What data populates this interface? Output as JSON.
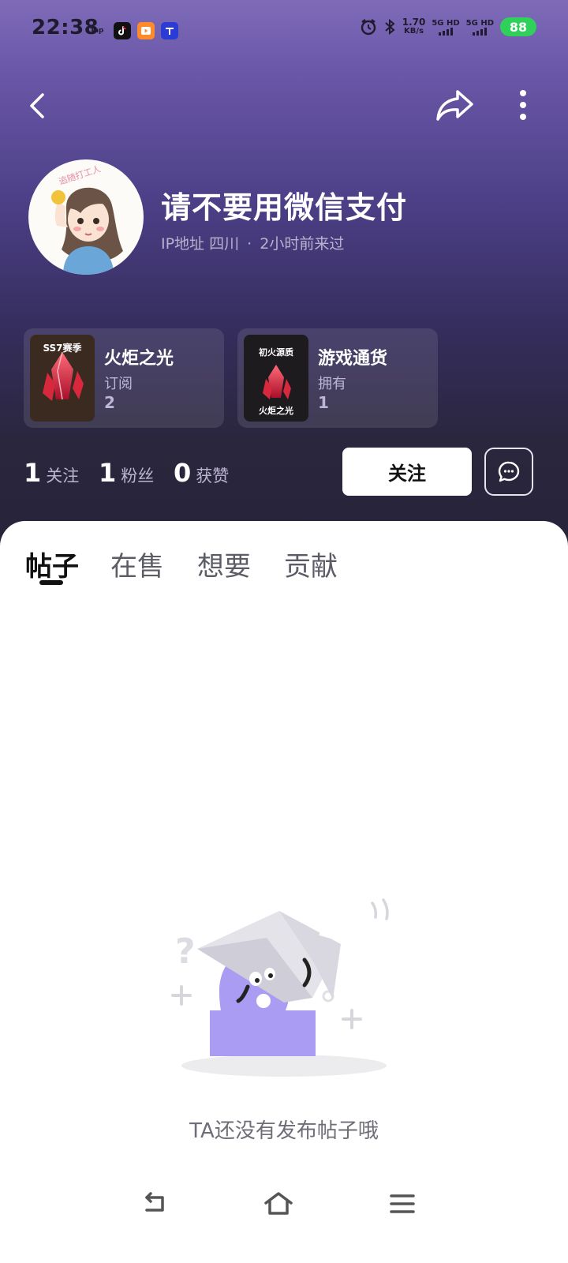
{
  "status_bar": {
    "time": "22:38",
    "apps": [
      "Tap",
      "douyin-icon",
      "video-app-icon",
      "qianyou-app-icon"
    ],
    "net_speed_value": "1.70",
    "net_speed_unit": "KB/s",
    "sim1": "5G HD",
    "sim2": "5G HD",
    "battery": "88"
  },
  "profile": {
    "username": "请不要用微信支付",
    "ip_location": "IP地址 四川",
    "separator": "·",
    "last_seen": "2小时前来过",
    "avatar_caption": "追随打工人"
  },
  "cards": [
    {
      "thumb_label": "SS7赛季",
      "title": "火炬之光",
      "subtitle": "订阅",
      "count": "2"
    },
    {
      "thumb_label_top": "初火源质",
      "thumb_label_bottom": "火炬之光",
      "title": "游戏通货",
      "subtitle": "拥有",
      "count": "1"
    }
  ],
  "stats": [
    {
      "num": "1",
      "label": "关注"
    },
    {
      "num": "1",
      "label": "粉丝"
    },
    {
      "num": "0",
      "label": "获赞"
    }
  ],
  "actions": {
    "follow_label": "关注"
  },
  "tabs": [
    {
      "label": "帖子",
      "active": true
    },
    {
      "label": "在售",
      "active": false
    },
    {
      "label": "想要",
      "active": false
    },
    {
      "label": "贡献",
      "active": false
    }
  ],
  "empty_state": {
    "message": "TA还没有发布帖子哦"
  },
  "colors": {
    "header_top": "#7e6bb8",
    "header_bottom": "#27243a",
    "battery": "#2fd15a",
    "mascot": "#a99cf2"
  }
}
